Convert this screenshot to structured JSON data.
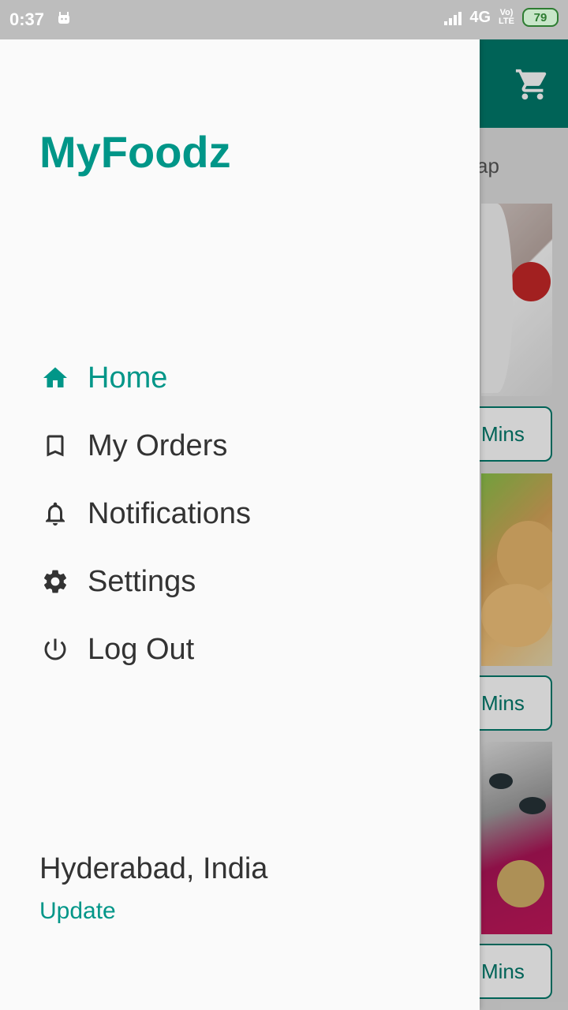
{
  "status_bar": {
    "time": "0:37",
    "network": "4G",
    "volte_top": "Vo)",
    "volte_bottom": "LTE",
    "battery": "79"
  },
  "background": {
    "search_chip_text": "ap",
    "delivery_times": [
      "Mins",
      "Mins",
      "Mins"
    ]
  },
  "drawer": {
    "brand": "MyFoodz",
    "items": [
      {
        "label": "Home",
        "icon": "home-icon",
        "active": true
      },
      {
        "label": "My Orders",
        "icon": "bookmark-icon",
        "active": false
      },
      {
        "label": "Notifications",
        "icon": "bell-icon",
        "active": false
      },
      {
        "label": "Settings",
        "icon": "gear-icon",
        "active": false
      },
      {
        "label": "Log Out",
        "icon": "power-icon",
        "active": false
      }
    ],
    "location": "Hyderabad, India",
    "update_label": "Update"
  },
  "colors": {
    "accent": "#009688",
    "appbar": "#00796b",
    "text": "#333333"
  }
}
